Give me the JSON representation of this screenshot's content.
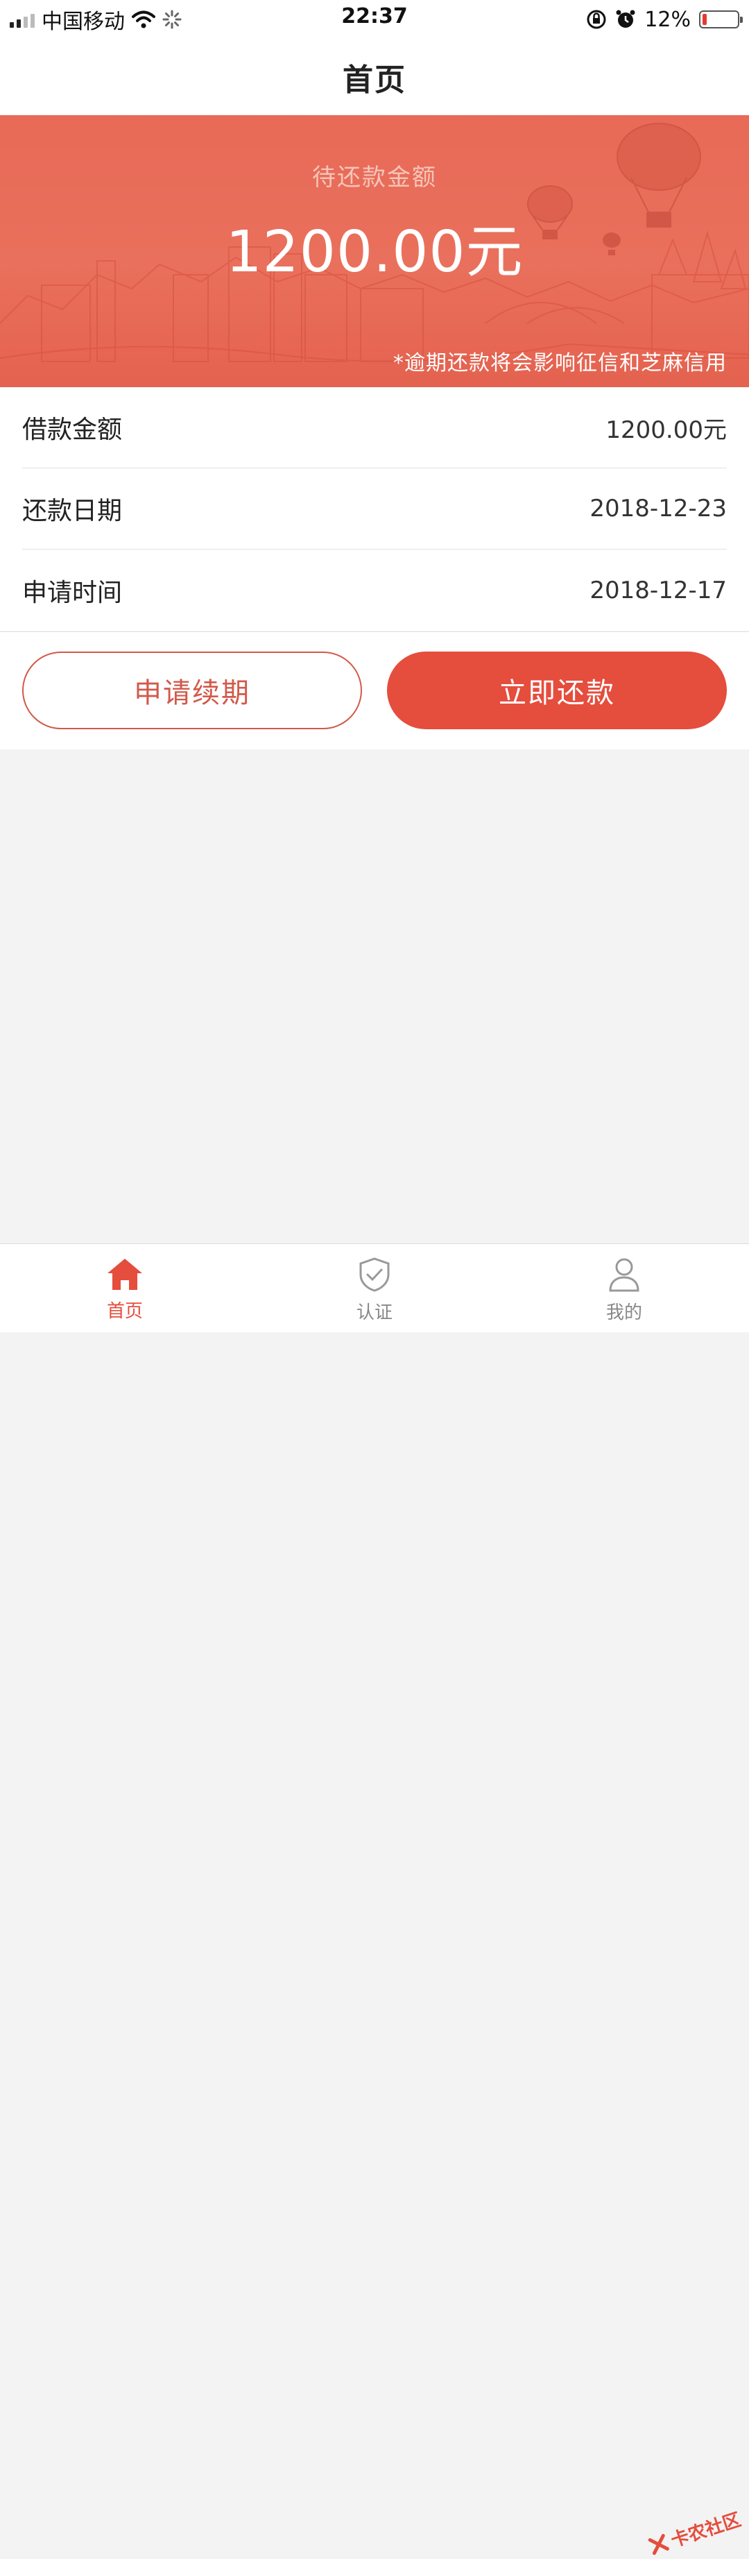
{
  "status_bar": {
    "carrier": "中国移动",
    "time": "22:37",
    "battery_percent_text": "12%",
    "battery_level": 0.12,
    "icons": [
      "signal-icon",
      "wifi-icon",
      "loading-icon",
      "orientation-lock-icon",
      "alarm-icon",
      "battery-icon"
    ]
  },
  "nav": {
    "title": "首页"
  },
  "hero": {
    "label": "待还款金额",
    "amount": "1200.00元",
    "note": "*逾期还款将会影响征信和芝麻信用"
  },
  "details": [
    {
      "label": "借款金额",
      "value": "1200.00元"
    },
    {
      "label": "还款日期",
      "value": "2018-12-23"
    },
    {
      "label": "申请时间",
      "value": "2018-12-17"
    }
  ],
  "actions": {
    "extend_label": "申请续期",
    "repay_label": "立即还款"
  },
  "tabs": [
    {
      "label": "首页",
      "icon": "home-icon",
      "active": true
    },
    {
      "label": "认证",
      "icon": "shield-check-icon",
      "active": false
    },
    {
      "label": "我的",
      "icon": "user-icon",
      "active": false
    }
  ],
  "watermark": {
    "text": "卡农社区"
  },
  "colors": {
    "accent": "#e54d3d",
    "hero_background": "#e86a57",
    "page_background": "#f3f3f3"
  }
}
